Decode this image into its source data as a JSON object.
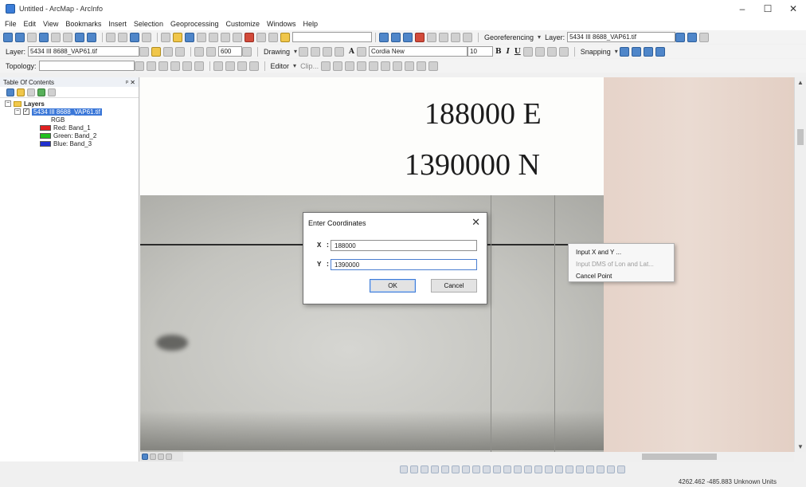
{
  "window": {
    "title": "Untitled - ArcMap - ArcInfo",
    "minimize": "–",
    "maximize": "☐",
    "close": "✕"
  },
  "menu": [
    "File",
    "Edit",
    "View",
    "Bookmarks",
    "Insert",
    "Selection",
    "Geoprocessing",
    "Customize",
    "Windows",
    "Help"
  ],
  "toolbar1": {
    "georeferencing_label": "Georeferencing",
    "layer_label": "Layer:",
    "layer_value": "5434 III 8688_VAP61.tif"
  },
  "toolbar2": {
    "layer_label": "Layer:",
    "layer_value": "5434 III 8688_VAP61.tif",
    "scale_value": "600",
    "drawing_label": "Drawing",
    "font_value": "Cordia New",
    "font_size": "10",
    "bold": "B",
    "italic": "I",
    "underline": "U",
    "text_a": "A",
    "snapping_label": "Snapping"
  },
  "toolbar3": {
    "topology_label": "Topology:",
    "editor_label": "Editor",
    "clip_label": "Clip..."
  },
  "toc": {
    "title": "Table Of Contents",
    "pin": "ᵖ ✕",
    "root": "Layers",
    "layer": "5434 III 8688_VAP61.tif",
    "rgb": "RGB",
    "bands": [
      {
        "label": "Red:  Band_1",
        "color": "#e02020"
      },
      {
        "label": "Green: Band_2",
        "color": "#20c020"
      },
      {
        "label": "Blue:  Band_3",
        "color": "#2030d0"
      }
    ]
  },
  "map": {
    "easting_label": "188000 E",
    "northing_label": "1390000 N"
  },
  "dialog": {
    "title": "Enter Coordinates",
    "x_label": "X :",
    "x_value": "188000",
    "y_label": "Y :",
    "y_value": "1390000",
    "ok": "OK",
    "cancel": "Cancel"
  },
  "context_menu": [
    {
      "label": "Input X and Y ...",
      "enabled": true
    },
    {
      "label": "Input DMS of Lon and Lat...",
      "enabled": false
    },
    {
      "label": "Cancel Point",
      "enabled": true
    }
  ],
  "status": {
    "coordinates": "4262.462  -485.883 Unknown Units"
  },
  "colors": {
    "selection": "#3c78d8",
    "dialog_focus": "#4a7ed1"
  }
}
